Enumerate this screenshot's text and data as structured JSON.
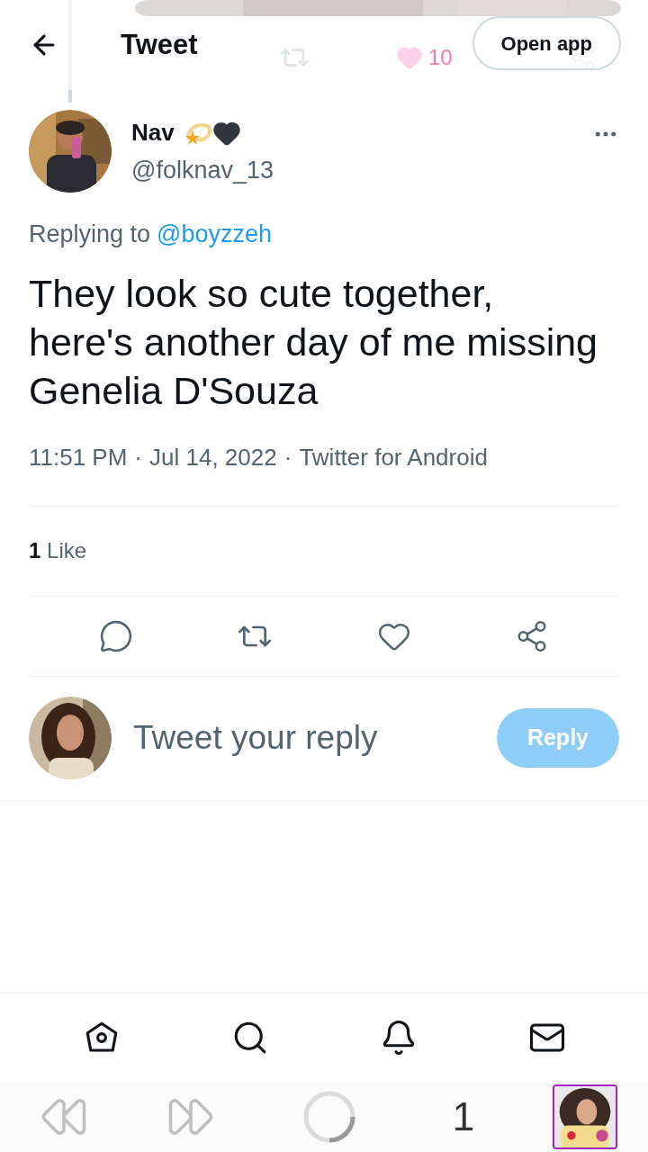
{
  "header": {
    "title": "Tweet",
    "open_app": "Open app",
    "faded_like_count": "10"
  },
  "tweet": {
    "name": "Nav",
    "handle": "@folknav_13",
    "replying_label": "Replying to",
    "replying_to": "@boyzzeh",
    "text": "They look so cute together, here's another day of me missing Genelia D'Souza",
    "time": "11:51 PM",
    "separator": "·",
    "date": "Jul 14, 2022",
    "source": "Twitter for Android",
    "likes_count": "1",
    "likes_label": "Like"
  },
  "reply": {
    "placeholder": "Tweet your reply",
    "button": "Reply",
    "disabled": true
  },
  "bottom_nav": [
    {
      "kind": "home"
    },
    {
      "kind": "search"
    },
    {
      "kind": "bell"
    },
    {
      "kind": "mail"
    }
  ],
  "system_bar": {
    "tab_count": "1"
  }
}
